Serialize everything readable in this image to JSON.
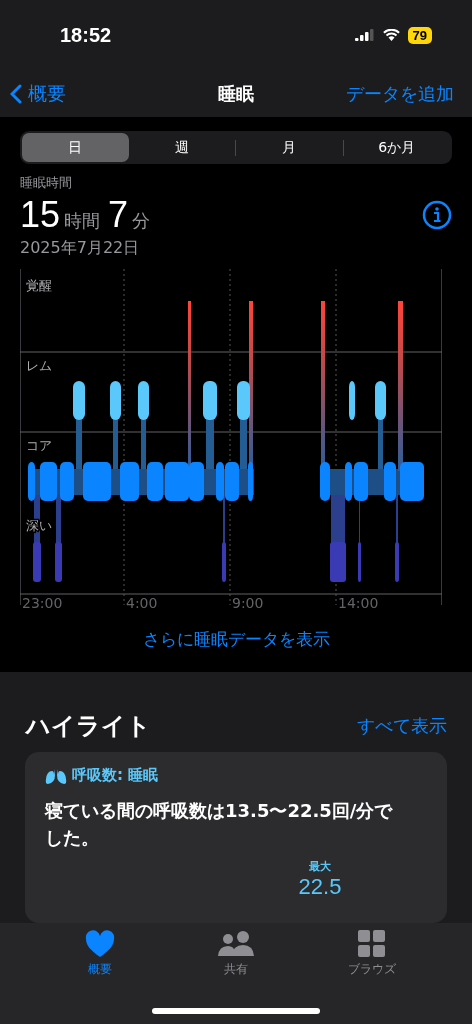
{
  "status_bar": {
    "time": "18:52",
    "battery": "79"
  },
  "nav": {
    "back": "概要",
    "title": "睡眠",
    "action": "データを追加"
  },
  "segments": [
    {
      "label": "日",
      "selected": true
    },
    {
      "label": "週",
      "selected": false
    },
    {
      "label": "月",
      "selected": false
    },
    {
      "label": "6か月",
      "selected": false
    }
  ],
  "summary": {
    "label": "睡眠時間",
    "hours": "15",
    "hours_unit": "時間",
    "minutes": "7",
    "minutes_unit": "分",
    "date": "2025年7月22日"
  },
  "hypnogram": {
    "stages": [
      "覚醒",
      "レム",
      "コア",
      "深い"
    ],
    "times": [
      "23:00",
      "4:00",
      "9:00",
      "14:00"
    ]
  },
  "more_link": "さらに睡眠データを表示",
  "highlights": {
    "title": "ハイライト",
    "show_all": "すべて表示",
    "card": {
      "category": "呼吸数: 睡眠",
      "text": "寝ている間の呼吸数は13.5〜22.5回/分でした。",
      "max_label": "最大",
      "max_value": "22.5"
    }
  },
  "tab_bar": [
    {
      "label": "概要",
      "selected": true
    },
    {
      "label": "共有",
      "selected": false
    },
    {
      "label": "ブラウズ",
      "selected": false
    }
  ]
}
